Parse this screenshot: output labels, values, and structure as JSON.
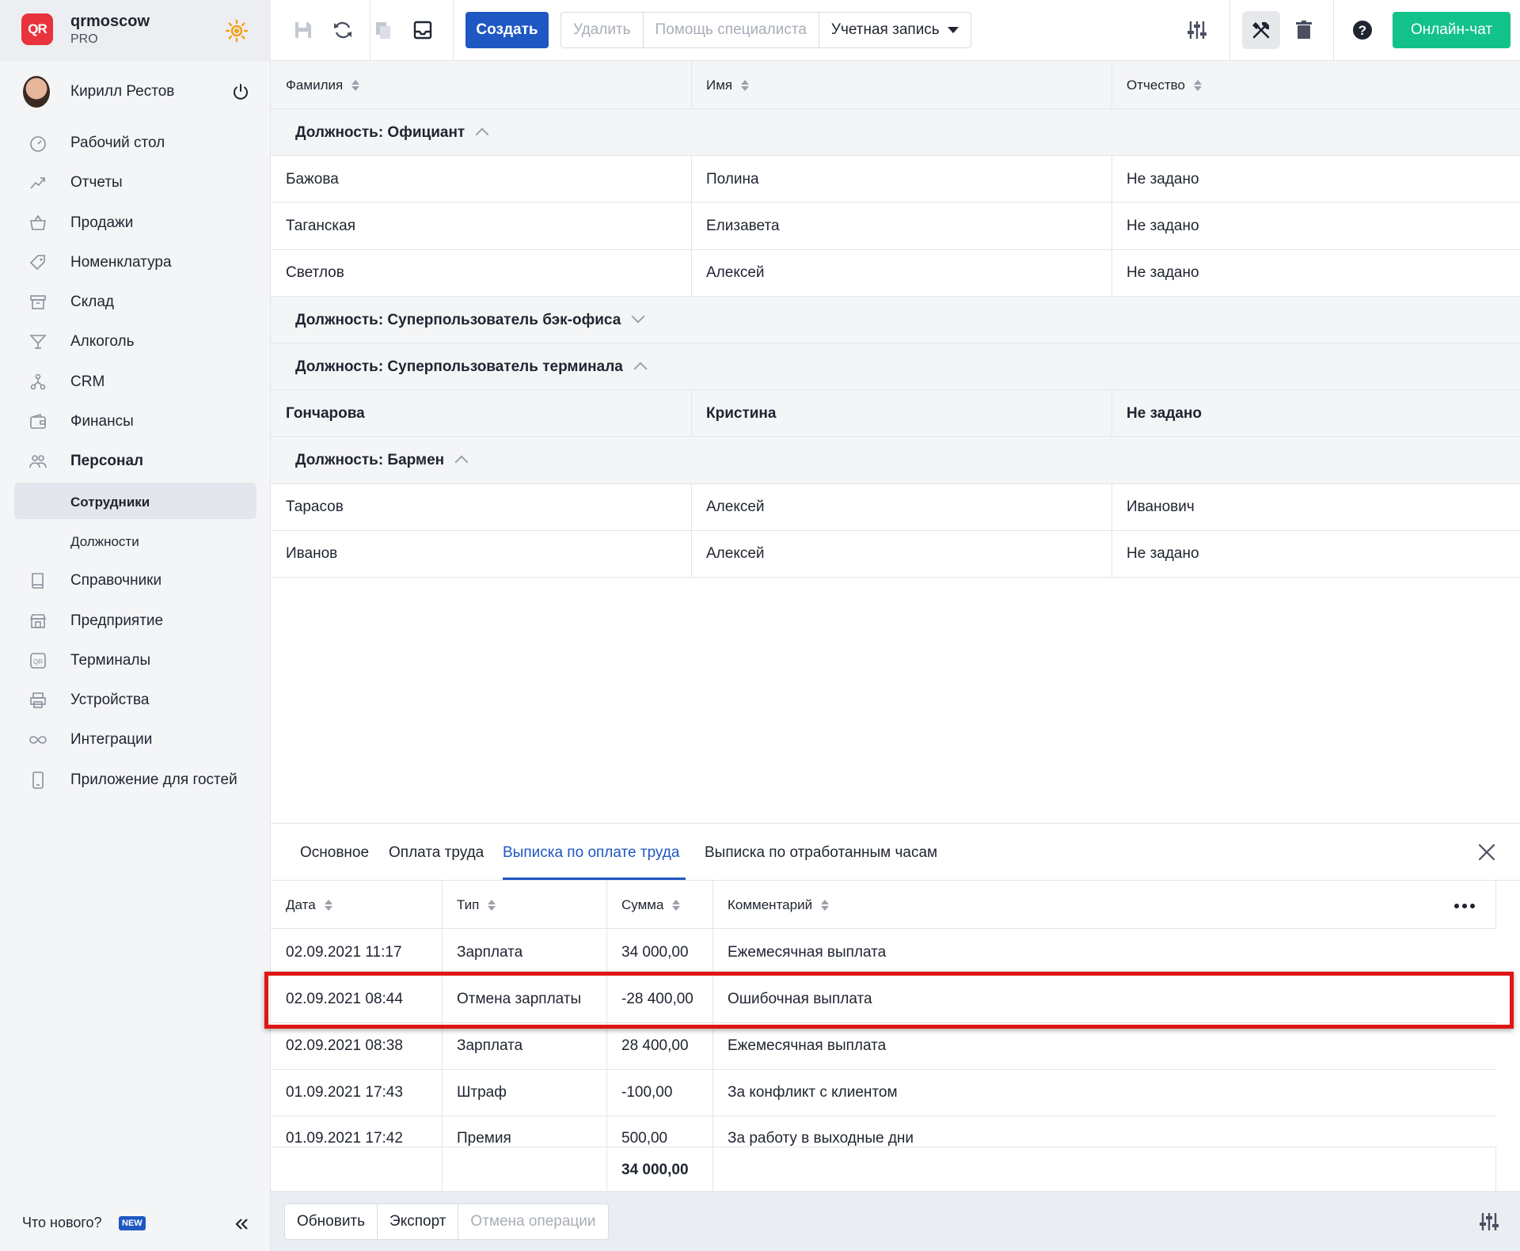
{
  "brand": {
    "name": "qrmoscow",
    "plan": "PRO",
    "logo_text": "QR"
  },
  "user": {
    "name": "Кирилл Рестов"
  },
  "nav": [
    {
      "label": "Рабочий стол",
      "icon": "dashboard-icon"
    },
    {
      "label": "Отчеты",
      "icon": "reports-icon"
    },
    {
      "label": "Продажи",
      "icon": "basket-icon"
    },
    {
      "label": "Номенклатура",
      "icon": "tag-icon"
    },
    {
      "label": "Склад",
      "icon": "archive-icon"
    },
    {
      "label": "Алкоголь",
      "icon": "cocktail-icon"
    },
    {
      "label": "CRM",
      "icon": "crm-icon"
    },
    {
      "label": "Финансы",
      "icon": "wallet-icon"
    },
    {
      "label": "Персонал",
      "icon": "people-icon"
    },
    {
      "label": "Сотрудники",
      "icon": ""
    },
    {
      "label": "Должности",
      "icon": ""
    },
    {
      "label": "Справочники",
      "icon": "book-icon"
    },
    {
      "label": "Предприятие",
      "icon": "store-icon"
    },
    {
      "label": "Терминалы",
      "icon": "terminal-icon"
    },
    {
      "label": "Устройства",
      "icon": "printer-icon"
    },
    {
      "label": "Интеграции",
      "icon": "infinity-icon"
    },
    {
      "label": "Приложение для гостей",
      "icon": "phone-icon"
    }
  ],
  "sidebar_footer": {
    "whats_new": "Что нового?",
    "badge": "NEW"
  },
  "toolbar": {
    "create": "Создать",
    "delete": "Удалить",
    "help": "Помощь специалиста",
    "account": "Учетная запись",
    "chat": "Онлайн-чат"
  },
  "table": {
    "columns": [
      "Фамилия",
      "Имя",
      "Отчество"
    ],
    "groups": [
      {
        "label": "Должность: Официант",
        "expanded": true,
        "rows": [
          [
            "Бажова",
            "Полина",
            "Не задано"
          ],
          [
            "Таганская",
            "Елизавета",
            "Не задано"
          ],
          [
            "Светлов",
            "Алексей",
            "Не задано"
          ]
        ]
      },
      {
        "label": "Должность: Суперпользователь бэк-офиса",
        "expanded": false,
        "rows": []
      },
      {
        "label": "Должность: Суперпользователь терминала",
        "expanded": true,
        "rows": [
          [
            "Гончарова",
            "Кристина",
            "Не задано"
          ]
        ]
      },
      {
        "label": "Должность: Бармен",
        "expanded": true,
        "rows": [
          [
            "Тарасов",
            "Алексей",
            "Иванович"
          ],
          [
            "Иванов",
            "Алексей",
            "Не задано"
          ]
        ]
      }
    ]
  },
  "panel": {
    "tabs": [
      "Основное",
      "Оплата труда",
      "Выписка по оплате труда",
      "Выписка по отработанным часам"
    ],
    "active_tab": "Выписка по оплате труда",
    "columns": [
      "Дата",
      "Тип",
      "Сумма",
      "Комментарий"
    ],
    "rows": [
      [
        "02.09.2021 11:17",
        "Зарплата",
        "34 000,00",
        "Ежемесячная выплата"
      ],
      [
        "02.09.2021 08:44",
        "Отмена зарплаты",
        "-28 400,00",
        "Ошибочная выплата"
      ],
      [
        "02.09.2021 08:38",
        "Зарплата",
        "28 400,00",
        "Ежемесячная выплата"
      ],
      [
        "01.09.2021 17:43",
        "Штраф",
        "-100,00",
        "За конфликт с клиентом"
      ],
      [
        "01.09.2021 17:42",
        "Премия",
        "500,00",
        "За работу в выходные дни"
      ]
    ],
    "total": "34 000,00"
  },
  "footer": {
    "refresh": "Обновить",
    "export": "Экспорт",
    "cancel": "Отмена операции"
  },
  "colors": {
    "accent": "#1f57c3",
    "chat": "#13c28a",
    "highlight": "#e01515",
    "logo": "#e8323c"
  }
}
